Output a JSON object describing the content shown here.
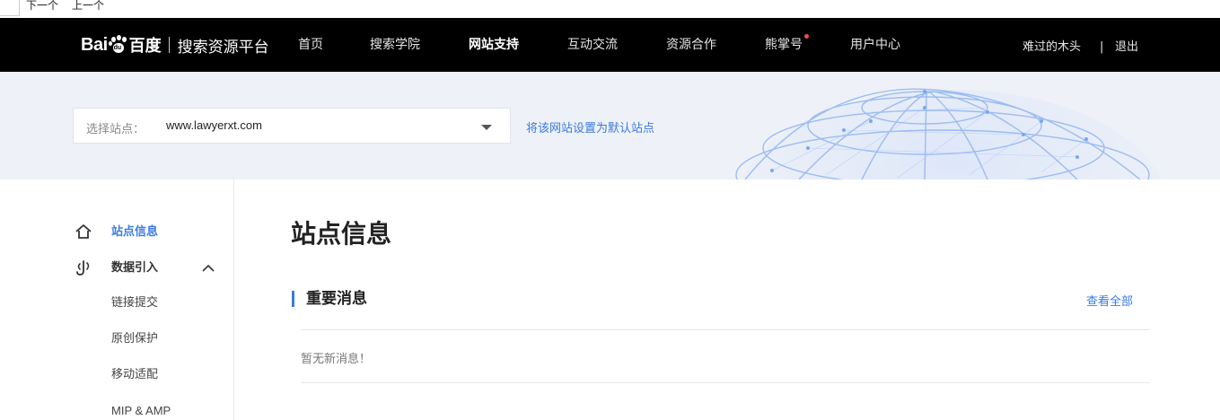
{
  "topstrip": {
    "next_label": "下一个",
    "prev_label": "上一个"
  },
  "navbar": {
    "logo_bai": "Bai",
    "logo_du": "du",
    "logo_baidu": "百度",
    "logo_platform": "搜索资源平台",
    "items": [
      {
        "label": "首页"
      },
      {
        "label": "搜索学院"
      },
      {
        "label": "网站支持",
        "active": true
      },
      {
        "label": "互动交流"
      },
      {
        "label": "资源合作"
      },
      {
        "label": "熊掌号",
        "badge": true
      },
      {
        "label": "用户中心"
      }
    ],
    "username": "难过的木头",
    "divider": "|",
    "logout": "退出",
    "badge_color": "#f44a4a"
  },
  "banner": {
    "site_label": "选择站点：",
    "site_value": "www.lawyerxt.com",
    "set_default": "将该网站设置为默认站点"
  },
  "sidebar": {
    "items": [
      {
        "label": "站点信息",
        "icon": "home-icon",
        "active": true
      },
      {
        "label": "数据引入",
        "icon": "data-import-icon",
        "expanded": true,
        "children": [
          {
            "label": "链接提交"
          },
          {
            "label": "原创保护"
          },
          {
            "label": "移动适配"
          },
          {
            "label": "MIP & AMP"
          }
        ]
      }
    ]
  },
  "main": {
    "title": "站点信息",
    "section_title": "重要消息",
    "see_all": "查看全部",
    "empty_message": "暂无新消息！"
  },
  "colors": {
    "accent": "#3b7be0",
    "nav_bg": "#000000",
    "banner_bg": "#eef1f7"
  }
}
